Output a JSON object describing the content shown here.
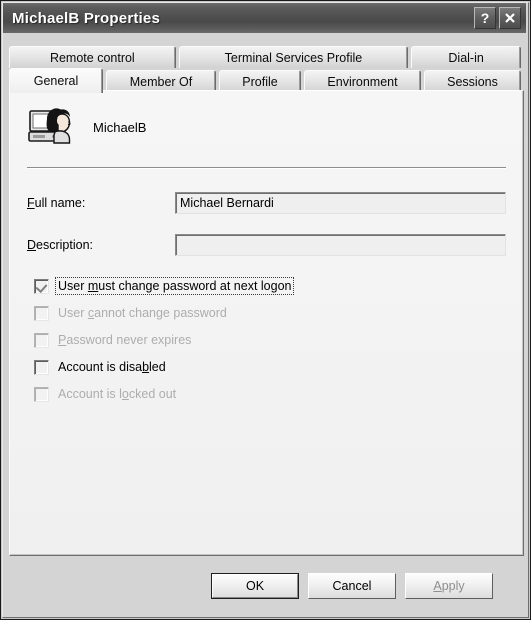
{
  "window": {
    "title": "MichaelB Properties",
    "help_button": "?",
    "close_button": "✕",
    "accent_titlebar": "#4f4f4f",
    "face_color": "#f1f1f1"
  },
  "tabs": {
    "top_row": [
      {
        "label": "Remote control",
        "active": false
      },
      {
        "label": "Terminal Services Profile",
        "active": false
      },
      {
        "label": "Dial-in",
        "active": false
      }
    ],
    "bottom_row": [
      {
        "label": "General",
        "active": true
      },
      {
        "label": "Member Of",
        "active": false
      },
      {
        "label": "Profile",
        "active": false
      },
      {
        "label": "Environment",
        "active": false
      },
      {
        "label": "Sessions",
        "active": false
      }
    ]
  },
  "general": {
    "icon_name": "user-account-icon",
    "account_name": "MichaelB",
    "fields": [
      {
        "label_prefix": "F",
        "label_rest": "ull name:",
        "value": "Michael Bernardi",
        "placeholder": ""
      },
      {
        "label_prefix": "D",
        "label_rest": "escription:",
        "value": "",
        "placeholder": ""
      }
    ],
    "options": [
      {
        "pre": "User ",
        "accel": "m",
        "post": "ust change password at next logon",
        "checked": true,
        "disabled": false,
        "focused": true
      },
      {
        "pre": "User ",
        "accel": "c",
        "post": "annot change password",
        "checked": false,
        "disabled": true,
        "focused": false
      },
      {
        "pre": "",
        "accel": "P",
        "post": "assword never expires",
        "checked": false,
        "disabled": true,
        "focused": false
      },
      {
        "pre": "Account is disa",
        "accel": "b",
        "post": "led",
        "checked": false,
        "disabled": false,
        "focused": false
      },
      {
        "pre": "Account is l",
        "accel": "o",
        "post": "cked out",
        "checked": false,
        "disabled": true,
        "focused": false
      }
    ]
  },
  "buttons": {
    "ok": "OK",
    "cancel": "Cancel",
    "apply_pre": "",
    "apply_accel": "A",
    "apply_post": "pply",
    "apply_disabled": true
  }
}
